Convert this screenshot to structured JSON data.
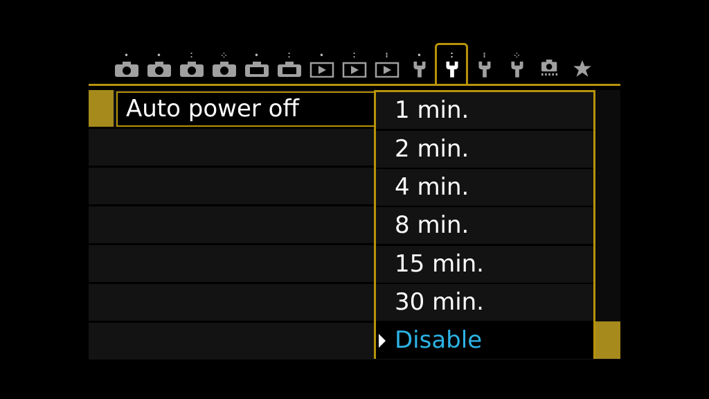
{
  "tabs": [
    {
      "icon": "camera-icon",
      "dots": "•",
      "label": ""
    },
    {
      "icon": "camera-icon",
      "dots": "•",
      "label": ""
    },
    {
      "icon": "camera-icon",
      "dots": "⁚",
      "label": ""
    },
    {
      "icon": "camera-icon",
      "dots": "⁘",
      "label": ""
    },
    {
      "icon": "camera-icon",
      "dots": "•",
      "label": ""
    },
    {
      "icon": "camera-icon",
      "dots": "⁚",
      "label": ""
    },
    {
      "icon": "playback-icon",
      "dots": "•",
      "label": ""
    },
    {
      "icon": "playback-icon",
      "dots": "⁚",
      "label": ""
    },
    {
      "icon": "playback-icon",
      "dots": "⁝",
      "label": ""
    },
    {
      "icon": "wrench-icon",
      "dots": "•",
      "label": ""
    },
    {
      "icon": "wrench-icon",
      "dots": "⁚",
      "label": ""
    },
    {
      "icon": "wrench-icon",
      "dots": "⁝",
      "label": ""
    },
    {
      "icon": "wrench-icon",
      "dots": "⁘",
      "label": ""
    },
    {
      "icon": "live-view-camera-icon",
      "dots": "",
      "label": ""
    },
    {
      "icon": "star-icon",
      "dots": "",
      "label": ""
    }
  ],
  "active_tab_index": 10,
  "colors": {
    "accent": "#b8930a",
    "selection_bar": "#a68a1c",
    "selected_option": "#2db3e6",
    "row_bg": "#131313"
  },
  "menu": {
    "item_label": "Auto power off"
  },
  "dropdown": {
    "options": [
      "1 min.",
      "2 min.",
      "4 min.",
      "8 min.",
      "15 min.",
      "30 min.",
      "Disable"
    ],
    "selected_index": 6
  }
}
